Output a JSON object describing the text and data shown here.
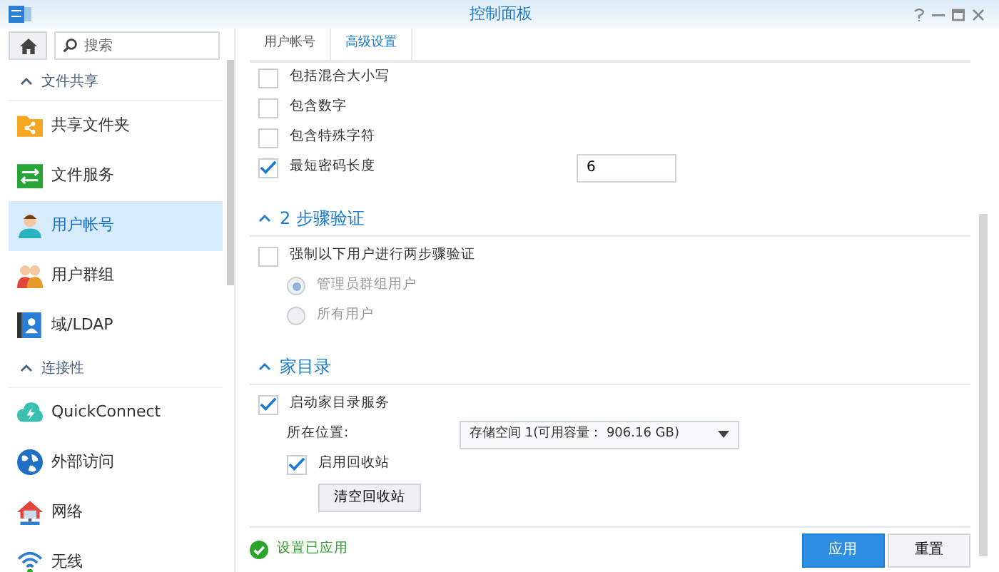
{
  "window": {
    "title": "控制面板"
  },
  "sidebar": {
    "search": {
      "placeholder": "搜索"
    },
    "sections": [
      {
        "label": "文件共享",
        "expanded": true,
        "items": [
          {
            "label": "共享文件夹",
            "selected": false
          },
          {
            "label": "文件服务",
            "selected": false
          },
          {
            "label": "用户帐号",
            "selected": true
          },
          {
            "label": "用户群组",
            "selected": false
          },
          {
            "label": "域/LDAP",
            "selected": false
          }
        ]
      },
      {
        "label": "连接性",
        "expanded": true,
        "items": [
          {
            "label": "QuickConnect",
            "selected": false
          },
          {
            "label": "外部访问",
            "selected": false
          },
          {
            "label": "网络",
            "selected": false
          },
          {
            "label": "无线",
            "selected": false
          }
        ]
      }
    ]
  },
  "tabs": [
    {
      "label": "用户帐号",
      "selected": false
    },
    {
      "label": "高级设置",
      "selected": true
    }
  ],
  "password_rules": [
    {
      "kind": "checkbox",
      "label": "包括混合大小写",
      "checked": false
    },
    {
      "kind": "checkbox",
      "label": "包含数字",
      "checked": false
    },
    {
      "kind": "checkbox",
      "label": "包含特殊字符",
      "checked": false
    },
    {
      "kind": "checkbox",
      "label": "最短密码长度",
      "checked": true,
      "value": "6"
    }
  ],
  "sections": [
    {
      "title": "2 步骤验证",
      "expanded": true,
      "rows": [
        {
          "kind": "checkbox",
          "label": "强制以下用户进行两步骤验证",
          "checked": false
        },
        {
          "kind": "radio",
          "label": "管理员群组用户",
          "selected": true,
          "disabled": true
        },
        {
          "kind": "radio",
          "label": "所有用户",
          "selected": false,
          "disabled": true
        }
      ]
    },
    {
      "title": "家目录",
      "expanded": true,
      "rows": [
        {
          "kind": "checkbox",
          "label": "启动家目录服务",
          "checked": true
        },
        {
          "kind": "select",
          "label": "所在位置:",
          "value": "存储空间 1(可用容量： 906.16 GB)"
        },
        {
          "kind": "subcheckbox",
          "label": "启用回收站",
          "checked": true
        },
        {
          "kind": "button",
          "label": "清空回收站"
        }
      ]
    }
  ],
  "status": {
    "text": "设置已应用"
  },
  "buttons": [
    {
      "label": "应用",
      "primary": true
    },
    {
      "label": "重置",
      "primary": false
    }
  ]
}
